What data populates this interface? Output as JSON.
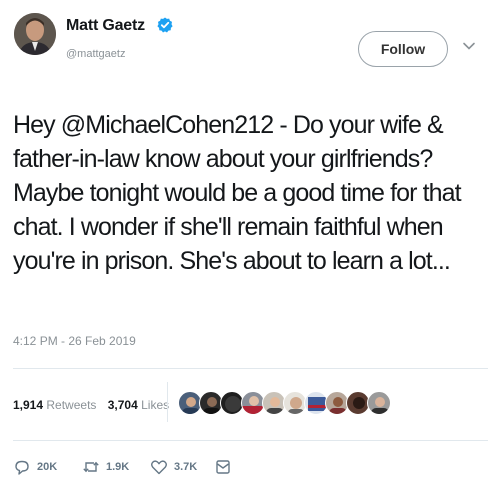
{
  "user": {
    "display_name": "Matt Gaetz",
    "handle": "@mattgaetz",
    "verified": true
  },
  "follow_label": "Follow",
  "tweet_lines": [
    "Hey @MichaelCohen212 - Do your wife &",
    "father-in-law know about your girlfriends?",
    "Maybe tonight would be a good time for that",
    "chat. I wonder if she'll remain faithful when",
    "you're in prison.  She's about to learn a lot..."
  ],
  "timestamp": "4:12 PM - 26 Feb 2019",
  "stats": {
    "retweets_count": "1,914",
    "retweets_label": "Retweets",
    "likes_count": "3,704",
    "likes_label": "Likes"
  },
  "actions": {
    "reply_count": "20K",
    "retweet_count": "1.9K",
    "like_count": "3.7K"
  },
  "colors": {
    "verified": "#1da1f2",
    "text": "#14171a",
    "muted": "#8a9196"
  }
}
